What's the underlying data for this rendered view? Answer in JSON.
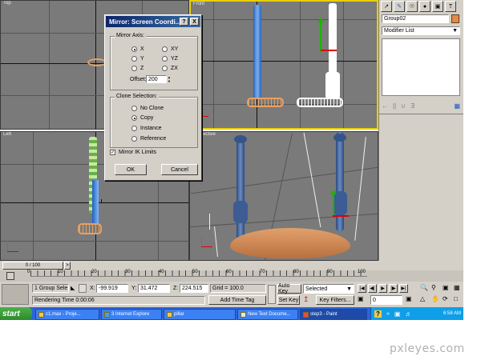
{
  "viewports": {
    "top_label": "Top",
    "front_label": "Front",
    "left_label": "Left",
    "perspective_label": "spective"
  },
  "dialog": {
    "title": "Mirror: Screen Coordi...",
    "help_btn": "?",
    "close_btn": "X",
    "mirror_axis_label": "Mirror Axis:",
    "axes": [
      "X",
      "Y",
      "Z",
      "XY",
      "YZ",
      "ZX"
    ],
    "selected_axis": "X",
    "offset_label": "Offset:",
    "offset_value": "200",
    "clone_selection_label": "Clone Selection:",
    "clone_options": [
      "No Clone",
      "Copy",
      "Instance",
      "Reference"
    ],
    "selected_clone": "Copy",
    "mirror_ik_label": "Mirror IK Limits",
    "mirror_ik_checked": true,
    "ok_label": "OK",
    "cancel_label": "Cancel"
  },
  "command_panel": {
    "object_name": "Group02",
    "modifier_list_label": "Modifier List"
  },
  "timeline": {
    "frame_counter": "0 / 100",
    "ticks": [
      "0",
      "10",
      "20",
      "30",
      "40",
      "50",
      "60",
      "70",
      "80",
      "90",
      "100"
    ]
  },
  "status": {
    "selection_text": "1 Group Sele",
    "x_label": "X:",
    "x_value": "-99.919",
    "y_label": "Y:",
    "y_value": "31.472",
    "z_label": "Z:",
    "z_value": "224.515",
    "grid_text": "Grid = 100.0",
    "rendering_time": "Rendering Time  0:00:06",
    "add_time_tag": "Add Time Tag",
    "auto_key": "Auto Key",
    "set_key": "Set Key",
    "selected_dropdown": "Selected",
    "key_filters": "Key Filters...",
    "frame_field": "0"
  },
  "taskbar": {
    "start_label": "start",
    "items": [
      {
        "label": "c1.max  - Proje..."
      },
      {
        "label": "3 Internet Explore"
      },
      {
        "label": "pillar"
      },
      {
        "label": "New Text Docume..."
      },
      {
        "label": "step3 - Paint"
      }
    ],
    "clock": "6:58 AM"
  },
  "watermark": "pxleyes.com"
}
